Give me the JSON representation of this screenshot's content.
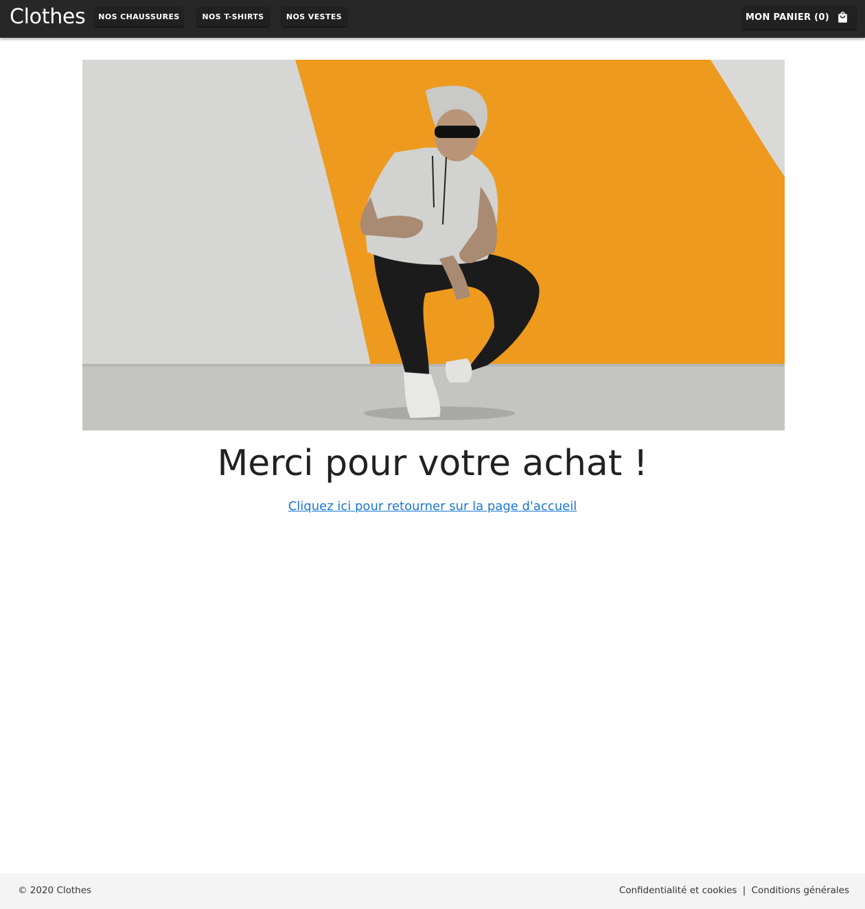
{
  "header": {
    "brand": "Clothes",
    "nav": [
      {
        "label": "NOS CHAUSSURES"
      },
      {
        "label": "NOS T-SHIRTS"
      },
      {
        "label": "NOS VESTES"
      }
    ],
    "cart_label": "MON PANIER (0)",
    "cart_icon": "shopping-bag-icon"
  },
  "main": {
    "heading": "Merci pour votre achat !",
    "home_link": "Cliquez ici pour retourner sur la page d'accueil"
  },
  "footer": {
    "copyright": "© 2020 Clothes",
    "privacy": "Confidentialité et cookies",
    "separator": "|",
    "terms": "Conditions générales"
  },
  "colors": {
    "appbar": "#272727",
    "accent_orange": "#ef9a1e",
    "link": "#1976d2",
    "footer_bg": "#f4f4f4"
  }
}
